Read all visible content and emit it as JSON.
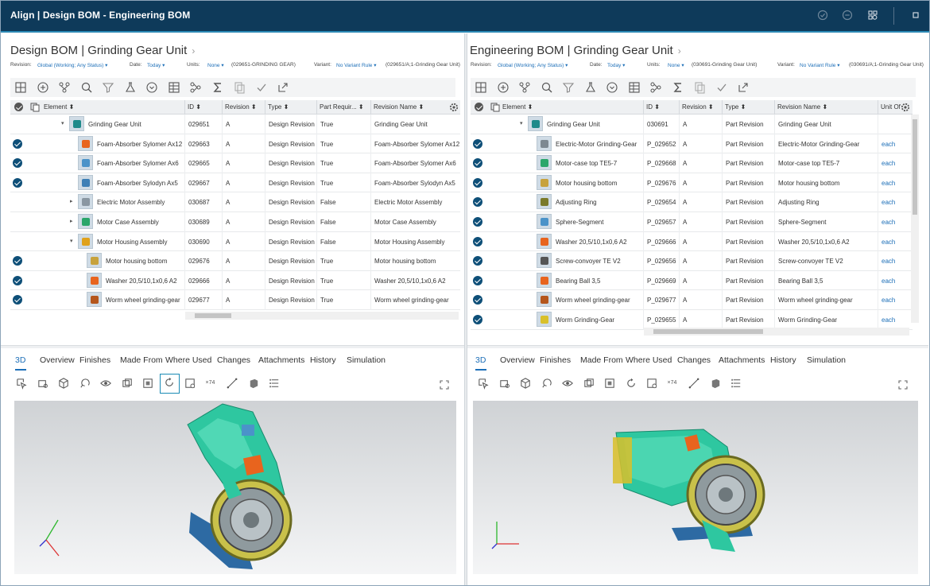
{
  "app": {
    "title": "Align | Design BOM - Engineering BOM"
  },
  "titlebar_icons": [
    "check-circle-icon",
    "minus-circle-icon",
    "settings-icon",
    "window-icon"
  ],
  "left": {
    "title": "Design BOM | Grinding Gear Unit",
    "filters": {
      "revision_label": "Revision:",
      "revision_value": "Global (Working; Any Status) ▾",
      "date_label": "Date:",
      "date_value": "Today ▾",
      "units_label": "Units:",
      "units_value": "None ▾",
      "units_extra": "(029651-GRINDING GEAR)",
      "variant_label": "Variant:",
      "variant_value": "No Variant Rule ▾",
      "variant_extra": "(029651/A;1-Grinding Gear Unit)"
    },
    "columns": [
      "Element ⬍",
      "ID ⬍",
      "Revision ⬍",
      "Type ⬍",
      "Part Requir... ⬍",
      "Revision Name ⬍"
    ],
    "rows": [
      {
        "check": false,
        "caret": "▾",
        "indent": 0,
        "element": "Grinding Gear Unit",
        "id": "029651",
        "rev": "A",
        "type": "Design Revision",
        "req": "True",
        "name": "Grinding Gear Unit",
        "color": "#1f8a8a"
      },
      {
        "check": true,
        "caret": "",
        "indent": 1,
        "element": "Foam-Absorber Sylomer Ax12",
        "id": "029663",
        "rev": "A",
        "type": "Design Revision",
        "req": "True",
        "name": "Foam-Absorber Sylomer Ax12",
        "color": "#e8641e"
      },
      {
        "check": true,
        "caret": "",
        "indent": 1,
        "element": "Foam-Absorber Sylomer Ax6",
        "id": "029665",
        "rev": "A",
        "type": "Design Revision",
        "req": "True",
        "name": "Foam-Absorber Sylomer Ax6",
        "color": "#4b93c9"
      },
      {
        "check": true,
        "caret": "",
        "indent": 1,
        "element": "Foam-Absorber Sylodyn Ax5",
        "id": "029667",
        "rev": "A",
        "type": "Design Revision",
        "req": "True",
        "name": "Foam-Absorber Sylodyn Ax5",
        "color": "#3d7fb6"
      },
      {
        "check": false,
        "caret": "▸",
        "indent": 1,
        "element": "Electric Motor Assembly",
        "id": "030687",
        "rev": "A",
        "type": "Design Revision",
        "req": "False",
        "name": "Electric Motor Assembly",
        "color": "#8a97a2"
      },
      {
        "check": false,
        "caret": "▸",
        "indent": 1,
        "element": "Motor Case Assembly",
        "id": "030689",
        "rev": "A",
        "type": "Design Revision",
        "req": "False",
        "name": "Motor Case Assembly",
        "color": "#2aa66a"
      },
      {
        "check": false,
        "caret": "▾",
        "indent": 1,
        "element": "Motor Housing Assembly",
        "id": "030690",
        "rev": "A",
        "type": "Design Revision",
        "req": "False",
        "name": "Motor Housing Assembly",
        "color": "#e0a21c"
      },
      {
        "check": true,
        "caret": "",
        "indent": 2,
        "element": "Motor housing bottom",
        "id": "029676",
        "rev": "A",
        "type": "Design Revision",
        "req": "True",
        "name": "Motor housing bottom",
        "color": "#c7a23c"
      },
      {
        "check": true,
        "caret": "",
        "indent": 2,
        "element": "Washer 20,5/10,1x0,6 A2",
        "id": "029666",
        "rev": "A",
        "type": "Design Revision",
        "req": "True",
        "name": "Washer 20,5/10,1x0,6 A2",
        "color": "#e8641e"
      },
      {
        "check": true,
        "caret": "",
        "indent": 2,
        "element": "Worm wheel grinding-gear",
        "id": "029677",
        "rev": "A",
        "type": "Design Revision",
        "req": "True",
        "name": "Worm wheel grinding-gear",
        "color": "#b5561c"
      }
    ],
    "tabs": [
      "3D",
      "Overview",
      "Finishes",
      "Made From",
      "Where Used",
      "Changes",
      "Attachments",
      "History",
      "Simulation"
    ]
  },
  "right": {
    "title": "Engineering BOM | Grinding Gear Unit",
    "filters": {
      "revision_label": "Revision:",
      "revision_value": "Global (Working; Any Status) ▾",
      "date_label": "Date:",
      "date_value": "Today ▾",
      "units_label": "Units:",
      "units_value": "None ▾",
      "units_extra": "(030691-Grinding Gear Unit)",
      "variant_label": "Variant:",
      "variant_value": "No Variant Rule ▾",
      "variant_extra": "(030691/A;1-Grinding Gear Unit)"
    },
    "columns": [
      "Element ⬍",
      "ID ⬍",
      "Revision ⬍",
      "Type ⬍",
      "Revision Name ⬍",
      "Unit Of"
    ],
    "rows": [
      {
        "check": false,
        "caret": "▾",
        "indent": 0,
        "element": "Grinding Gear Unit",
        "id": "030691",
        "rev": "A",
        "type": "Part Revision",
        "name": "Grinding Gear Unit",
        "unit": "",
        "color": "#1f8a8a"
      },
      {
        "check": true,
        "caret": "",
        "indent": 1,
        "element": "Electric-Motor Grinding-Gear",
        "id": "P_029652",
        "rev": "A",
        "type": "Part Revision",
        "name": "Electric-Motor Grinding-Gear",
        "unit": "each",
        "color": "#7d8891"
      },
      {
        "check": true,
        "caret": "",
        "indent": 1,
        "element": "Motor-case top TE5-7",
        "id": "P_029668",
        "rev": "A",
        "type": "Part Revision",
        "name": "Motor-case top TE5-7",
        "unit": "each",
        "color": "#2aa66a"
      },
      {
        "check": true,
        "caret": "",
        "indent": 1,
        "element": "Motor housing bottom",
        "id": "P_029676",
        "rev": "A",
        "type": "Part Revision",
        "name": "Motor housing bottom",
        "unit": "each",
        "color": "#c7a23c"
      },
      {
        "check": true,
        "caret": "",
        "indent": 1,
        "element": "Adjusting Ring",
        "id": "P_029654",
        "rev": "A",
        "type": "Part Revision",
        "name": "Adjusting Ring",
        "unit": "each",
        "color": "#7a7a2a"
      },
      {
        "check": true,
        "caret": "",
        "indent": 1,
        "element": "Sphere-Segment",
        "id": "P_029657",
        "rev": "A",
        "type": "Part Revision",
        "name": "Sphere-Segment",
        "unit": "each",
        "color": "#4b93c9"
      },
      {
        "check": true,
        "caret": "",
        "indent": 1,
        "element": "Washer 20,5/10,1x0,6 A2",
        "id": "P_029666",
        "rev": "A",
        "type": "Part Revision",
        "name": "Washer 20,5/10,1x0,6 A2",
        "unit": "each",
        "color": "#e8641e"
      },
      {
        "check": true,
        "caret": "",
        "indent": 1,
        "element": "Screw-convoyer TE V2",
        "id": "P_029656",
        "rev": "A",
        "type": "Part Revision",
        "name": "Screw-convoyer TE V2",
        "unit": "each",
        "color": "#555555"
      },
      {
        "check": true,
        "caret": "",
        "indent": 1,
        "element": "Bearing Ball 3,5",
        "id": "P_029669",
        "rev": "A",
        "type": "Part Revision",
        "name": "Bearing Ball 3,5",
        "unit": "each",
        "color": "#e8641e"
      },
      {
        "check": true,
        "caret": "",
        "indent": 1,
        "element": "Worm wheel grinding-gear",
        "id": "P_029677",
        "rev": "A",
        "type": "Part Revision",
        "name": "Worm wheel grinding-gear",
        "unit": "each",
        "color": "#b5561c"
      },
      {
        "check": true,
        "caret": "",
        "indent": 1,
        "element": "Worm Grinding-Gear",
        "id": "P_029655",
        "rev": "A",
        "type": "Part Revision",
        "name": "Worm Grinding-Gear",
        "unit": "each",
        "color": "#d9c02a"
      }
    ],
    "tabs": [
      "3D",
      "Overview",
      "Finishes",
      "Made From",
      "Where Used",
      "Changes",
      "Attachments",
      "History",
      "Simulation"
    ]
  },
  "toolbar_icons": [
    "grid-icon",
    "add-icon",
    "structure-icon",
    "search-icon",
    "filter-icon",
    "flask-icon",
    "dropdown-circle-icon",
    "table-icon",
    "tree-icon",
    "sigma-icon",
    "copy-icon",
    "checkmark-icon",
    "export-icon"
  ],
  "viewer_icons": [
    "cursor-select-icon",
    "zoom-icon",
    "cube-icon",
    "rotate-icon",
    "eye-icon",
    "section-icon",
    "fit-icon",
    "spin-icon",
    "camera-icon",
    "measure-icon",
    "line-icon",
    "box-icon",
    "list-icon"
  ],
  "viewer_label": "×74",
  "colors": {
    "titlebar": "#0e3a5a",
    "accent": "#1d6fb8",
    "check": "#0e4f78"
  }
}
